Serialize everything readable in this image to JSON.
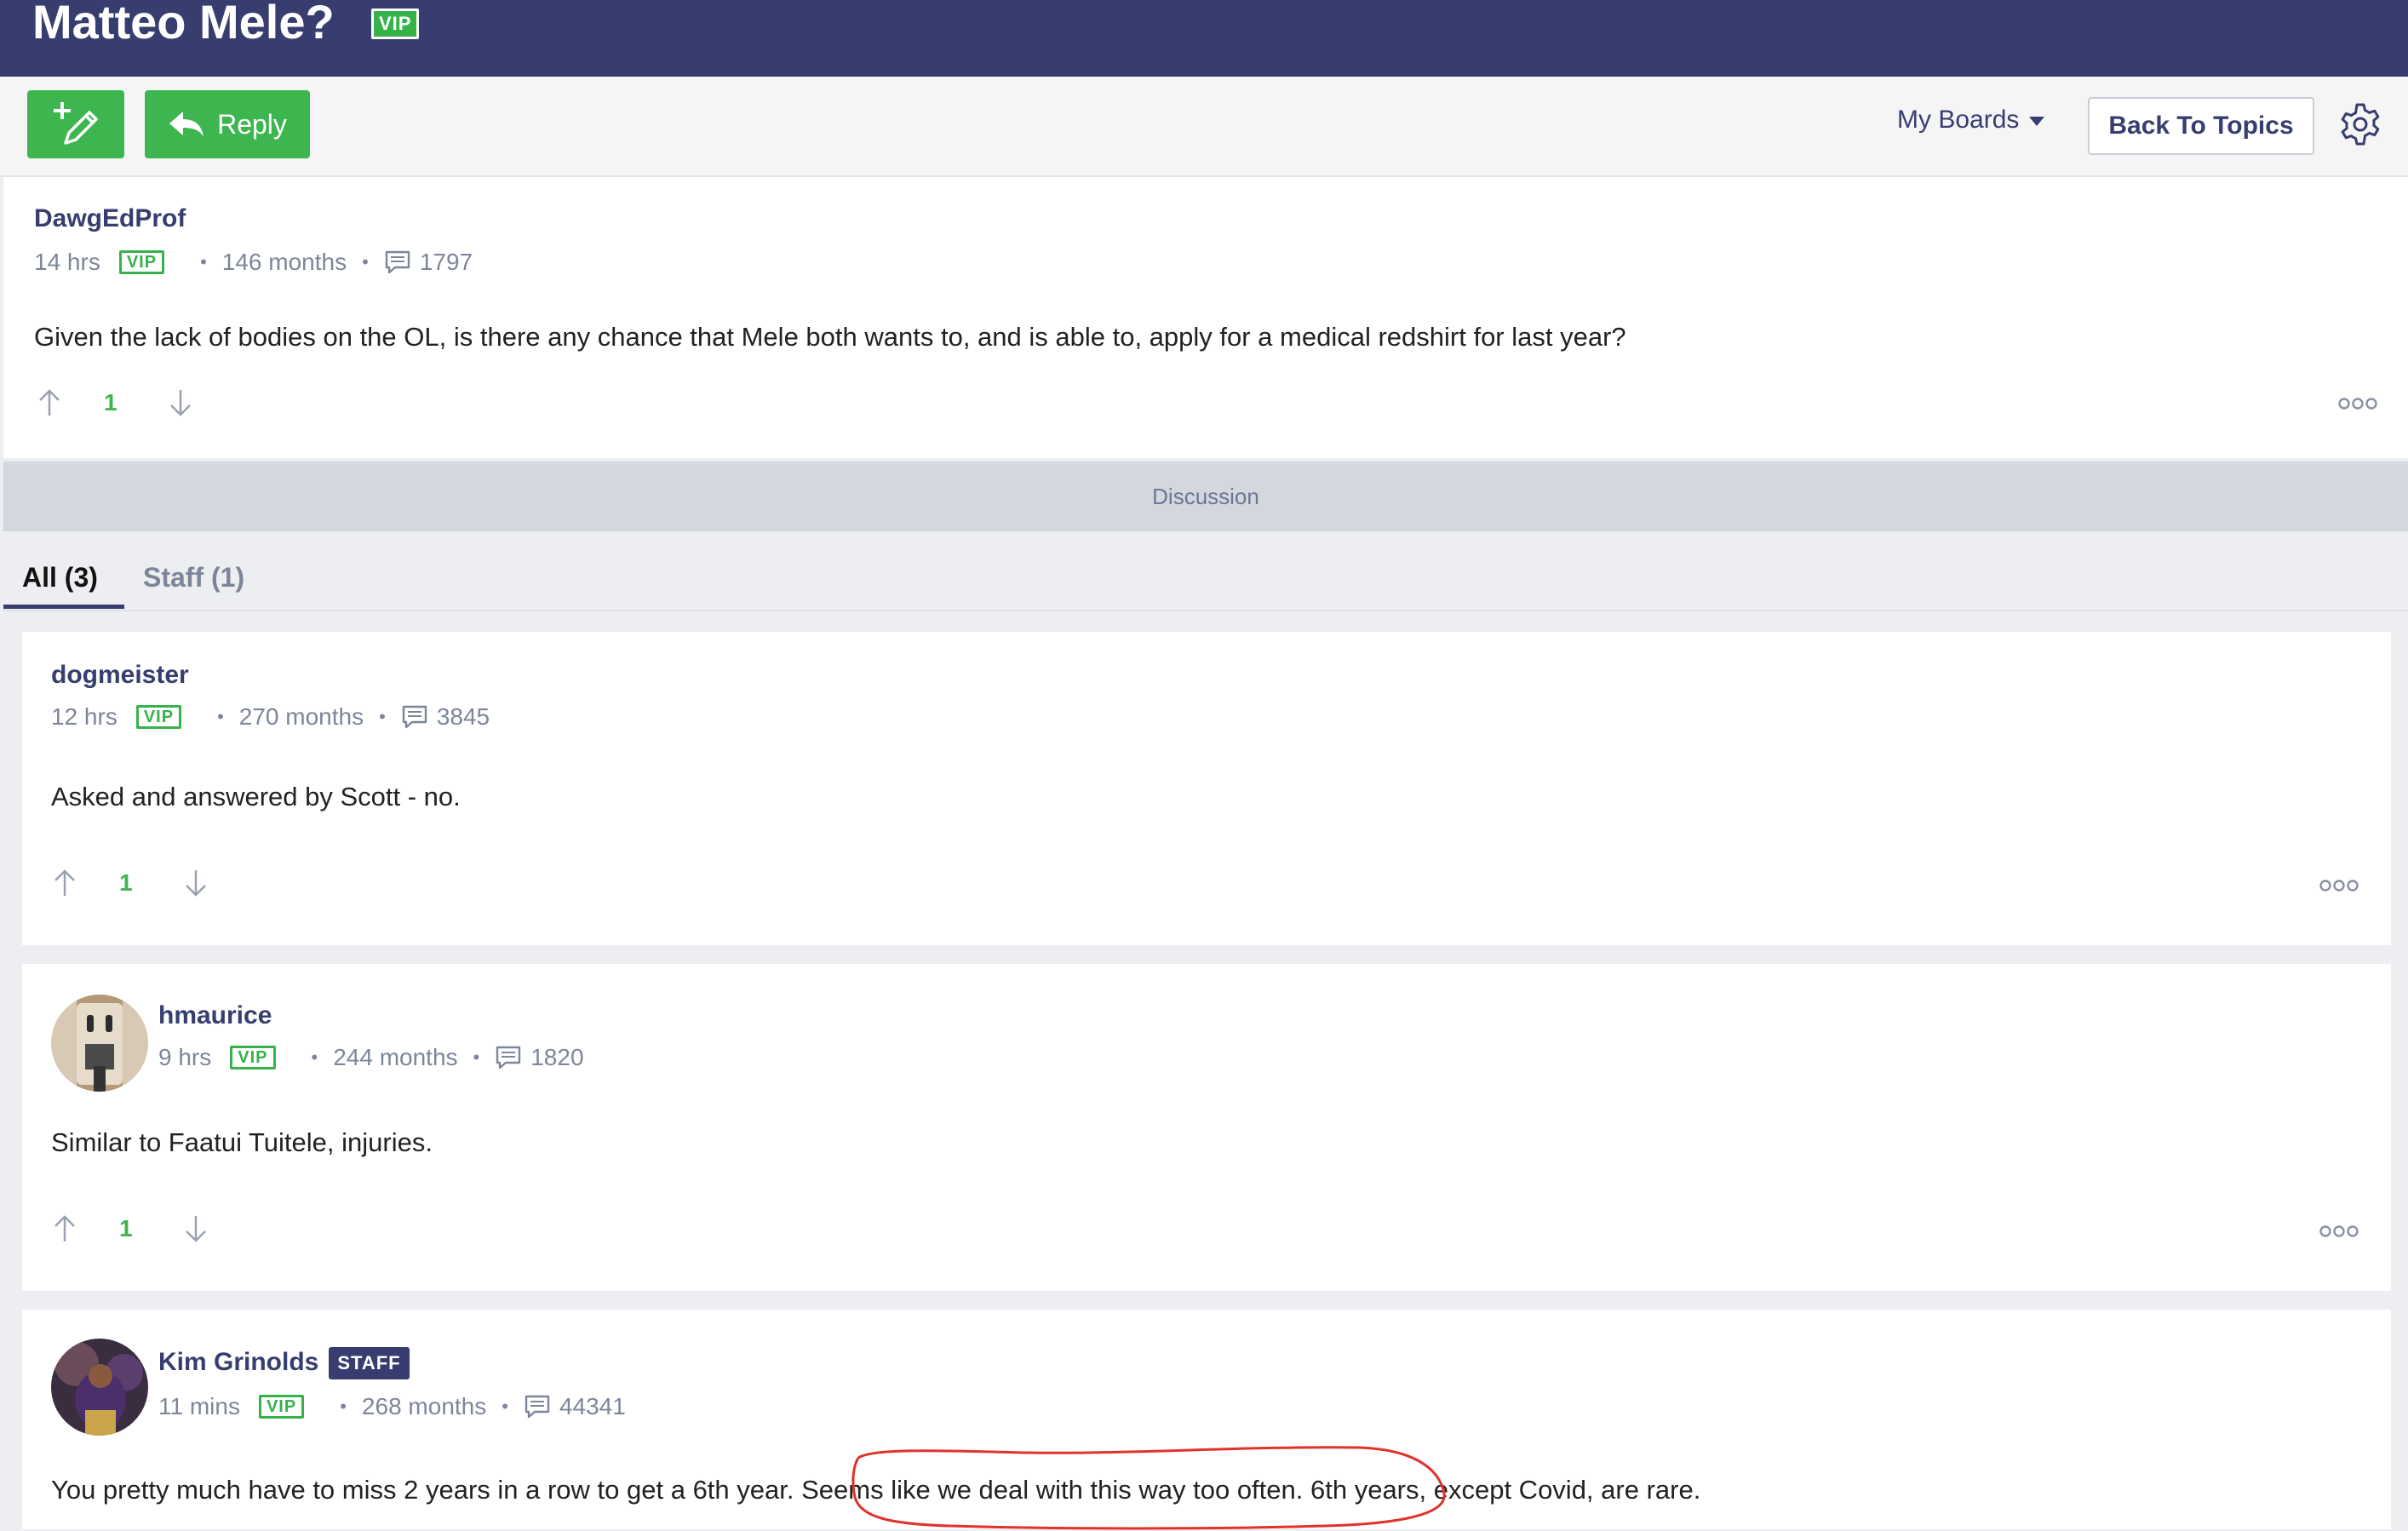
{
  "topic": {
    "title": "Matteo Mele?",
    "badge": "VIP"
  },
  "toolbar": {
    "new_post_icon": "pencil-plus-icon",
    "reply_label": "Reply",
    "my_boards_label": "My Boards",
    "back_label": "Back To Topics",
    "settings_icon": "gear-icon"
  },
  "original_post": {
    "author": "DawgEdProf",
    "time": "14 hrs",
    "badge": "VIP",
    "tenure": "146 months",
    "post_count": "1797",
    "body": "Given the lack of bodies on the OL, is there any chance that Mele both wants to, and is able to, apply for a medical redshirt for last year?",
    "votes": "1"
  },
  "discussion": {
    "label": "Discussion",
    "tabs": [
      {
        "label": "All (3)"
      },
      {
        "label": "Staff (1)"
      }
    ]
  },
  "replies": [
    {
      "author": "dogmeister",
      "time": "12 hrs",
      "badge": "VIP",
      "tenure": "270 months",
      "post_count": "3845",
      "body": "Asked and answered by Scott - no.",
      "votes": "1"
    },
    {
      "author": "hmaurice",
      "time": "9 hrs",
      "badge": "VIP",
      "tenure": "244 months",
      "post_count": "1820",
      "body": "Similar to Faatui Tuitele, injuries.",
      "votes": "1"
    },
    {
      "author": "Kim Grinolds",
      "staff_badge": "STAFF",
      "time": "11 mins",
      "badge": "VIP",
      "tenure": "268 months",
      "post_count": "44341",
      "body": "You pretty much have to miss 2 years in a row to get a 6th year. Seems like we deal with this way too often. 6th years, except Covid, are rare."
    }
  ],
  "colors": {
    "header": "#373e6f",
    "accent_green": "#3eb64f",
    "annotation": "#e0332b"
  }
}
